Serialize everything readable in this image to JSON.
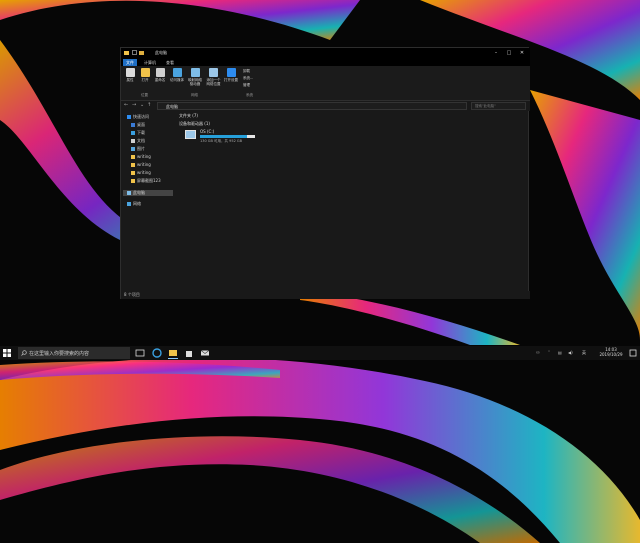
{
  "explorer": {
    "window_title": "此电脑",
    "ribbon_tabs": [
      "文件",
      "计算机",
      "查看"
    ],
    "ribbon_buttons": [
      "属性",
      "打开",
      "重命名",
      "访问媒体",
      "映射网络驱动器",
      "添加一个网络位置",
      "打开设置"
    ],
    "ribbon_small": [
      "卸载",
      "系统...",
      "管理"
    ],
    "ribbon_groups": [
      "位置",
      "网络",
      "系统"
    ],
    "address": "此电脑",
    "search_placeholder": "搜索\"此电脑\"",
    "nav_items": [
      "快速访问",
      "桌面",
      "下载",
      "文档",
      "图片",
      "writing",
      "writing",
      "writing",
      "屏幕截图123",
      "此电脑",
      "网络"
    ],
    "sections": {
      "folders": "文件夹 (7)",
      "devices": "设备和驱动器 (1)"
    },
    "drive": {
      "name": "OS (C:)",
      "size": "130 GB 可用，共 952 GB",
      "used_fraction": 0.86
    },
    "status": "8 个项目"
  },
  "taskbar": {
    "search_placeholder": "在这里输入你要搜索的内容",
    "time": "14:03",
    "date": "2019/10/29"
  },
  "colors": {
    "accent": "#1f6fc5",
    "drive_bar": "#26a0da"
  }
}
